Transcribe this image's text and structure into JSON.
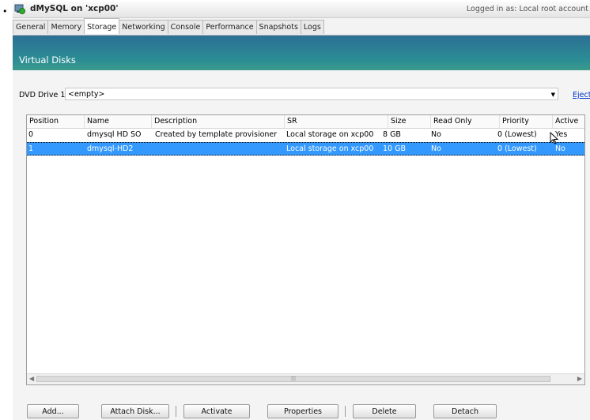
{
  "bullet": "•",
  "window": {
    "title": "dMySQL on 'xcp00'",
    "logged_in": "Logged in as:  Local root account"
  },
  "tabs": [
    "General",
    "Memory",
    "Storage",
    "Networking",
    "Console",
    "Performance",
    "Snapshots",
    "Logs"
  ],
  "active_tab": "Storage",
  "panel": {
    "title": "Virtual Disks"
  },
  "dvd": {
    "label": "DVD Drive 1:",
    "value": "<empty>",
    "eject_label": "Eject"
  },
  "table": {
    "columns": [
      "Position",
      "Name",
      "Description",
      "SR",
      "Size",
      "Read Only",
      "Priority",
      "Active"
    ],
    "rows": [
      {
        "position": "0",
        "name": "dmysql HD SO",
        "description": "Created by template provisioner",
        "sr": "Local storage on xcp00",
        "size": "8 GB",
        "read_only": "No",
        "priority": "0 (Lowest)",
        "active": "Yes",
        "selected": false
      },
      {
        "position": "1",
        "name": "dmysql-HD2",
        "description": "",
        "sr": "Local storage on xcp00",
        "size": "10 GB",
        "read_only": "No",
        "priority": "0 (Lowest)",
        "active": "No",
        "selected": true
      }
    ]
  },
  "buttons": {
    "add": "Add...",
    "attach": "Attach Disk...",
    "activate": "Activate",
    "properties": "Properties",
    "delete": "Delete",
    "detach": "Detach"
  },
  "colors": {
    "header_gradient_start": "#2d6f95",
    "header_gradient_end": "#3a9a8c",
    "selection": "#3399ff",
    "link": "#0033cc"
  }
}
